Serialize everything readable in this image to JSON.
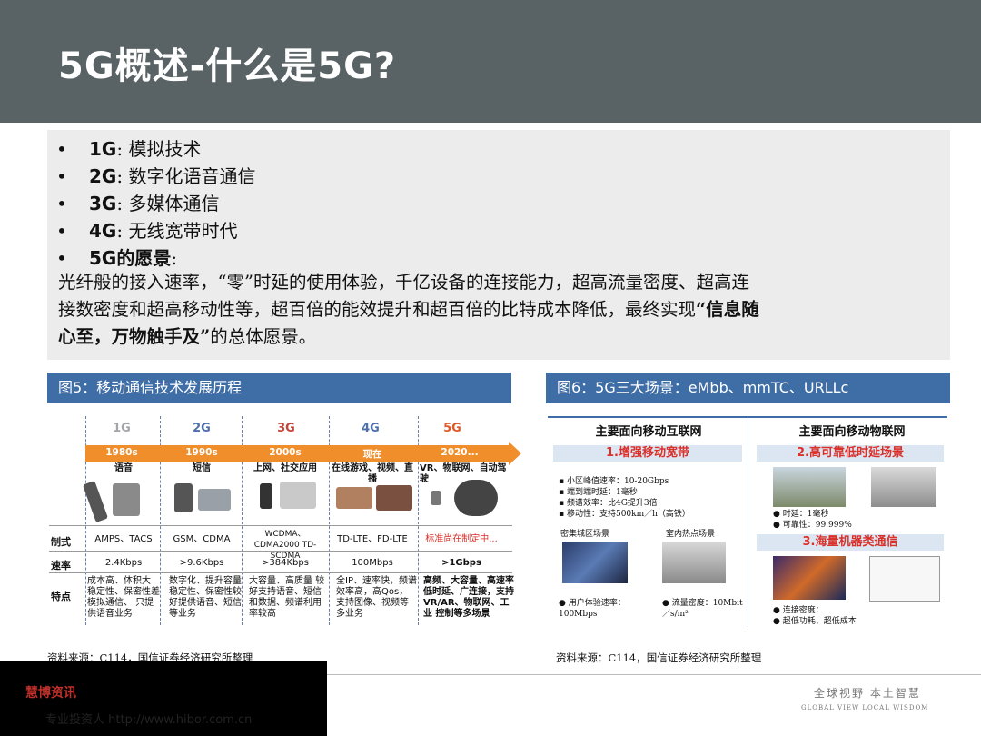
{
  "title": "5G概述-什么是5G?",
  "bullets": [
    {
      "key": "1G",
      "text": ": 模拟技术"
    },
    {
      "key": "2G",
      "text": ": 数字化语音通信"
    },
    {
      "key": "3G",
      "text": ": 多媒体通信"
    },
    {
      "key": "4G",
      "text": ": 无线宽带时代"
    },
    {
      "key": "5G的愿景",
      "text": ":"
    }
  ],
  "paragraph": {
    "line1": "光纤般的接入速率，“零”时延的使用体验，千亿设备的连接能力，超高流量密度、超高连",
    "line2a": "接数密度和超高移动性等，超百倍的能效提升和超百倍的比特成本降低，最终实现",
    "line2b": "“信息随",
    "line3a": "心至，万物触手及”",
    "line3b": "的总体愿景。"
  },
  "fig5": {
    "header": "图5：移动通信技术发展历程",
    "generations": [
      "1G",
      "2G",
      "3G",
      "4G",
      "5G"
    ],
    "eras": [
      "1980s",
      "1990s",
      "2000s",
      "现在",
      "2020..."
    ],
    "apps": [
      "语音",
      "短信",
      "上网、社交应用",
      "在线游戏、视频、直播",
      "VR、物联网、自动驾驶"
    ],
    "rows": {
      "standard_label": "制式",
      "standard": [
        "AMPS、TACS",
        "GSM、CDMA",
        "WCDMA、CDMA2000 TD-SCDMA",
        "TD-LTE、FD-LTE",
        "标准尚在制定中..."
      ],
      "speed_label": "速率",
      "speed": [
        "2.4Kbps",
        ">9.6Kbps",
        ">384Kbps",
        "100Mbps",
        ">1Gbps"
      ],
      "feature_label": "特点",
      "features": [
        "成本高、体积大 稳定性、保密性差 模拟通信、 只提供语音业务",
        "数字化、提升容量 稳定性、保密性较 好提供语音、短信 等业务",
        "大容量、高质量 较好支持语音、短信 和数据、频谱利用 率较高",
        "全IP、速率快，频谱 效率高，高Qos， 支持图像、视频等 多业务",
        "高频、大容量、高速率 低时延、广连接，支持 VR/AR、物联网、工业 控制等多场景"
      ]
    },
    "source": "资料来源：C114，国信证券经济研究所整理"
  },
  "fig6": {
    "header": "图6：5G三大场景：eMbb、mmTC、URLLc",
    "left_title": "主要面向移动互联网",
    "right_title": "主要面向移动物联网",
    "s1": "1.增强移动宽带",
    "s2": "2.高可靠低时延场景",
    "s3": "3.海量机器类通信",
    "s1_points": [
      "小区峰值速率：10-20Gbps",
      "端到端时延：1毫秒",
      "频谱效率：比4G提升3倍",
      "移动性：支持500km／h（高铁）"
    ],
    "s1_cap_left": "密集城区场景",
    "s1_cap_right": "室内热点场景",
    "s1_bottom_left": "用户体验速率：100Mbps",
    "s1_bottom_right": "流量密度：10Mbit／s/m²",
    "s2_points": [
      "时延：1毫秒",
      "可靠性：99.999%"
    ],
    "s3_points": [
      "连接密度：",
      "超低功耗、超低成本"
    ],
    "source": "资料来源：C114，国信证券经济研究所整理"
  },
  "footer": {
    "brand": "慧博资讯",
    "url": "专业投资人   http://www.hibor.com.cn",
    "slogan": "全球视野  本土智慧",
    "slogan_en": "GLOBAL VIEW   LOCAL WISDOM"
  },
  "colors": {
    "header_bg": "#596264",
    "accent_blue": "#3f6ea6",
    "arrow_orange": "#ef8e2b",
    "scenario_red": "#d9302a"
  }
}
